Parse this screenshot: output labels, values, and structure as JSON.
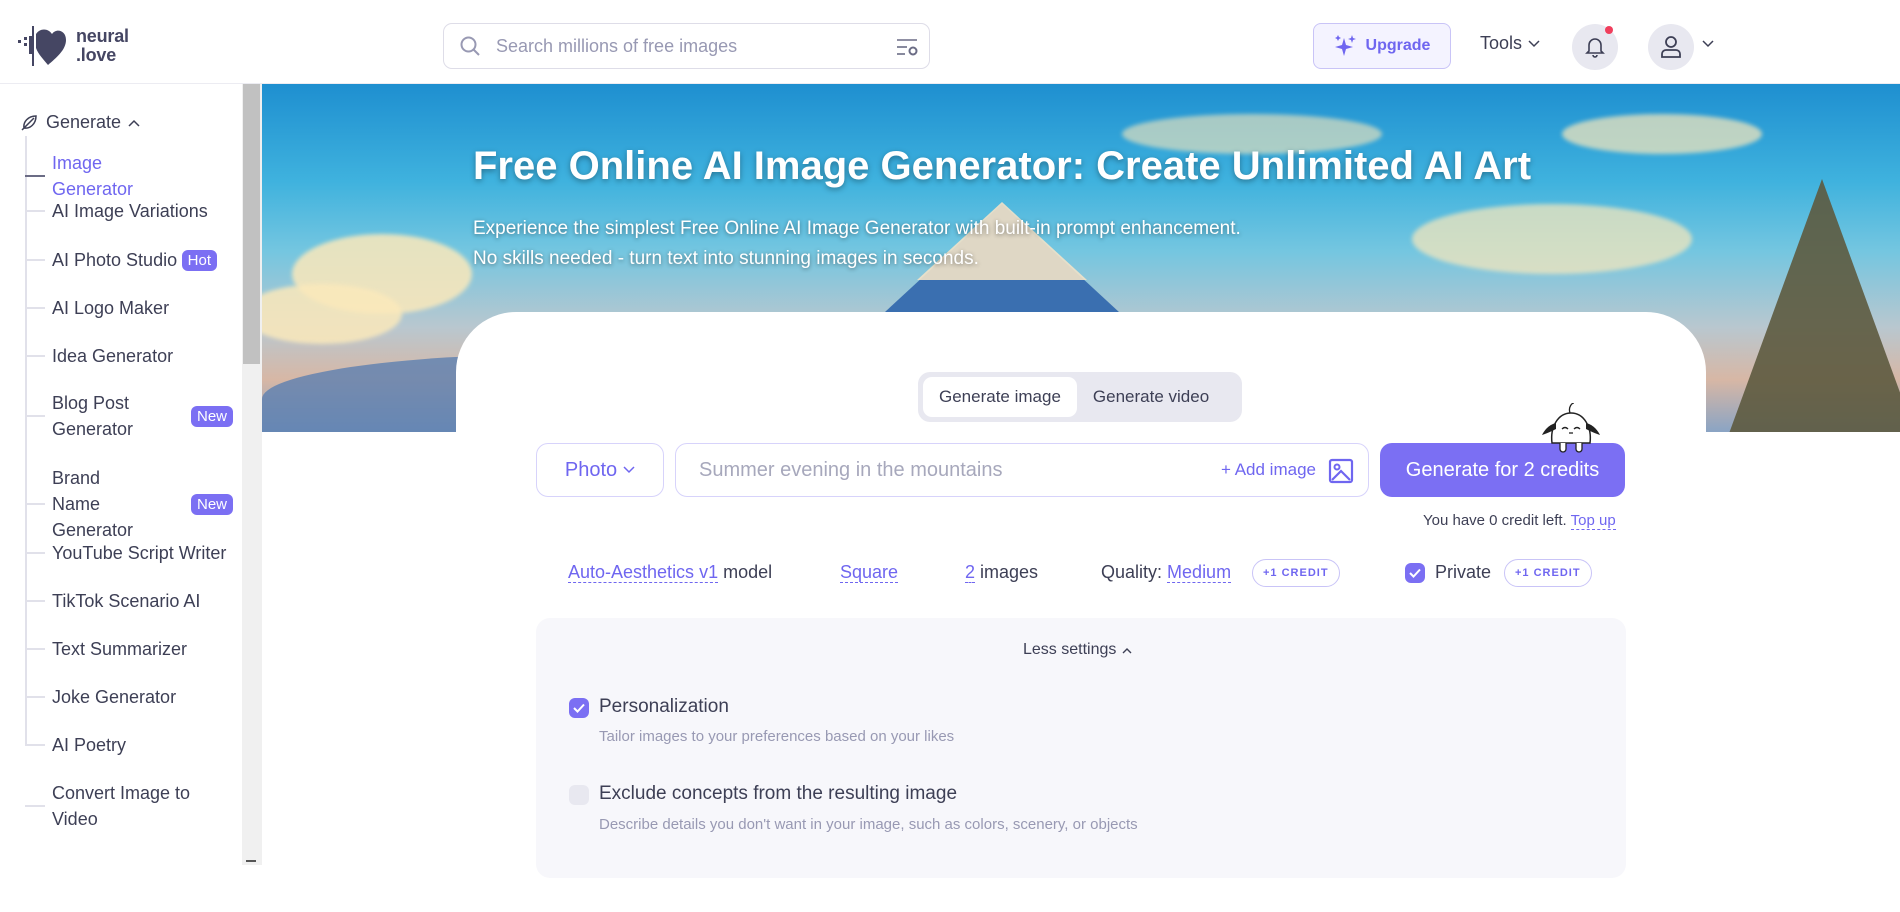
{
  "header": {
    "logo_line1": "neural",
    "logo_line2": ".love",
    "search_placeholder": "Search millions of free images",
    "upgrade_label": "Upgrade",
    "tools_label": "Tools",
    "has_notification": true
  },
  "sidebar": {
    "section_label": "Generate",
    "items": [
      {
        "label": "Image Generator",
        "active": true
      },
      {
        "label": "AI Image Variations"
      },
      {
        "label": "AI Photo Studio",
        "badge": "Hot"
      },
      {
        "label": "AI Logo Maker"
      },
      {
        "label": "Idea Generator"
      },
      {
        "label": "Blog Post Generator",
        "badge": "New"
      },
      {
        "label": "Brand Name Generator",
        "badge": "New"
      },
      {
        "label": "YouTube Script Writer"
      },
      {
        "label": "TikTok Scenario AI"
      },
      {
        "label": "Text Summarizer"
      },
      {
        "label": "Joke Generator"
      },
      {
        "label": "AI Poetry"
      },
      {
        "label": "Convert Image to Video"
      }
    ]
  },
  "hero": {
    "title": "Free Online AI Image Generator: Create Unlimited AI Art",
    "subtitle_line1": "Experience the simplest Free Online AI Image Generator with built-in prompt enhancement.",
    "subtitle_line2": "No skills needed - turn text into stunning images in seconds."
  },
  "generator": {
    "tabs": [
      {
        "label": "Generate image",
        "active": true
      },
      {
        "label": "Generate video"
      }
    ],
    "style_select": "Photo",
    "prompt_placeholder": "Summer evening in the mountains",
    "add_image_label": "+ Add image",
    "generate_label": "Generate for 2 credits",
    "credits_text": "You have 0 credit left.",
    "topup_label": "Top up",
    "options": {
      "model_value": "Auto-Aesthetics v1",
      "model_suffix": "model",
      "aspect": "Square",
      "count_value": "2",
      "count_suffix": "images",
      "quality_prefix": "Quality:",
      "quality_value": "Medium",
      "quality_cost": "+1 CREDIT",
      "private_label": "Private",
      "private_checked": true,
      "private_cost": "+1 CREDIT"
    },
    "settings": {
      "toggle_label": "Less settings",
      "personalization_title": "Personalization",
      "personalization_desc": "Tailor images to your preferences based on your likes",
      "personalization_checked": true,
      "exclude_title": "Exclude concepts from the resulting image",
      "exclude_desc": "Describe details you don't want in your image, such as colors, scenery, or objects",
      "exclude_checked": false
    }
  },
  "colors": {
    "accent": "#7b6ff3",
    "accent_text": "#6f66f0",
    "notification": "#f03e5c"
  }
}
